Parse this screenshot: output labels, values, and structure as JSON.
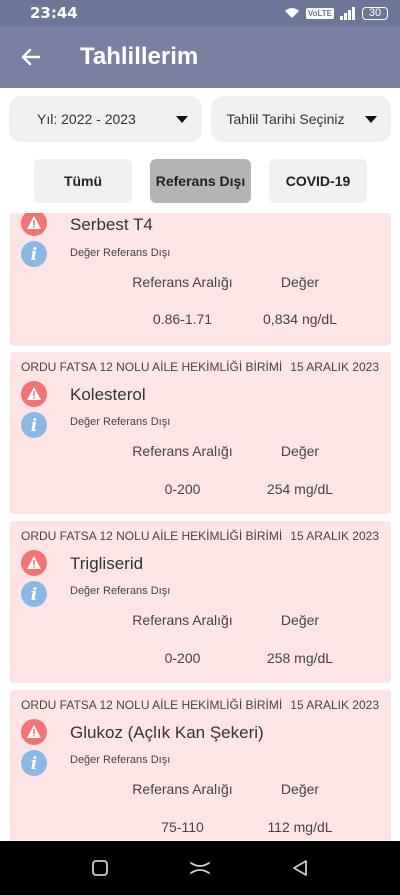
{
  "status_bar": {
    "time": "23:44",
    "volte": "VoLTE",
    "battery": "30"
  },
  "app_bar": {
    "title": "Tahlillerim"
  },
  "filters": {
    "year": "Yıl: 2022 - 2023",
    "date": "Tahlil Tarihi Seçiniz"
  },
  "tabs": [
    {
      "label": "Tümü",
      "active": false
    },
    {
      "label": "Referans Dışı",
      "active": true
    },
    {
      "label": "COVID-19",
      "active": false
    }
  ],
  "results": [
    {
      "facility": "",
      "date": "",
      "test": "Serbest T4",
      "status": "Değer Referans Dışı",
      "ref_label": "Referans Aralığı",
      "val_label": "Değer",
      "ref": "0.86-1.71",
      "value": "0,834 ng/dL"
    },
    {
      "facility": "ORDU FATSA 12 NOLU AİLE HEKİMLİĞİ BİRİMİ",
      "date": "15 ARALIK 2023",
      "test": "Kolesterol",
      "status": "Değer Referans Dışı",
      "ref_label": "Referans Aralığı",
      "val_label": "Değer",
      "ref": "0-200",
      "value": "254 mg/dL"
    },
    {
      "facility": "ORDU FATSA 12 NOLU AİLE HEKİMLİĞİ BİRİMİ",
      "date": "15 ARALIK 2023",
      "test": "Trigliserid",
      "status": "Değer Referans Dışı",
      "ref_label": "Referans Aralığı",
      "val_label": "Değer",
      "ref": "0-200",
      "value": "258 mg/dL"
    },
    {
      "facility": "ORDU FATSA 12 NOLU AİLE HEKİMLİĞİ BİRİMİ",
      "date": "15 ARALIK 2023",
      "test": "Glukoz (Açlık Kan Şekeri)",
      "status": "Değer Referans Dışı",
      "ref_label": "Referans Aralığı",
      "val_label": "Değer",
      "ref": "75-110",
      "value": "112 mg/dL"
    }
  ],
  "icons": {
    "warning": "warning-triangle-icon",
    "info": "info-icon",
    "back": "arrow-left-icon"
  },
  "colors": {
    "app_bar": "#7980a1",
    "status_bar": "#6e7697",
    "card_bg": "#fde5e5",
    "warning_red": "#f07474",
    "info_blue": "#8db8e3"
  }
}
